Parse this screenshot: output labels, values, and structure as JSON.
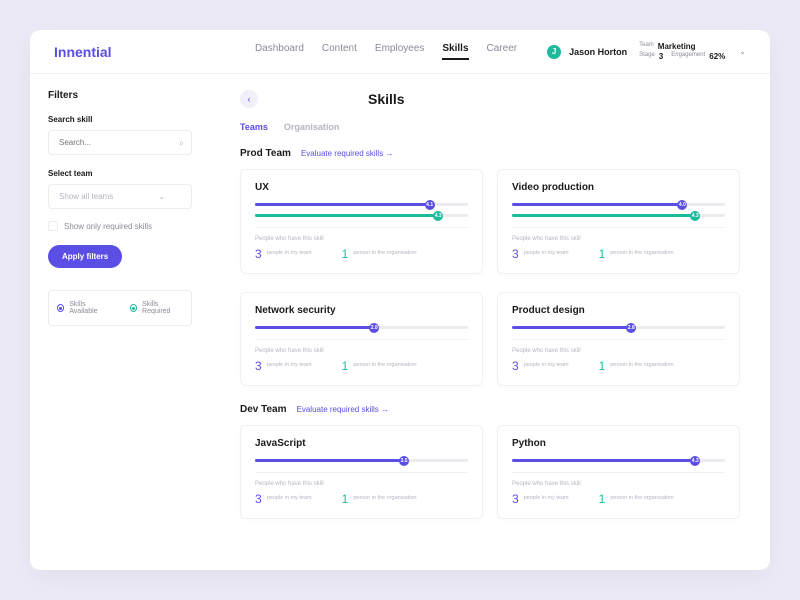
{
  "brand": "Innential",
  "nav": {
    "items": [
      "Dashboard",
      "Content",
      "Employees",
      "Skills",
      "Career"
    ],
    "activeIndex": 3
  },
  "user": {
    "initial": "J",
    "name": "Jason Horton",
    "teamLabel": "Team",
    "teamValue": "Marketing",
    "stageLabel": "Stage",
    "stageValue": "3",
    "engagementLabel": "Engagement",
    "engagementValue": "62%"
  },
  "sidebar": {
    "filtersTitle": "Filters",
    "searchLabel": "Search skill",
    "searchPlaceholder": "Search...",
    "selectTeamLabel": "Select team",
    "selectTeamValue": "Show all teams",
    "checkboxLabel": "Show only required skills",
    "applyLabel": "Apply filters",
    "legend": {
      "available": "Skills Available",
      "required": "Skills Required"
    }
  },
  "page": {
    "title": "Skills",
    "tabs": [
      "Teams",
      "Organisation"
    ],
    "activeTab": 0,
    "evaluateLabel": "Evaluate required skills →"
  },
  "teams": [
    {
      "name": "Prod Team",
      "cards": [
        {
          "title": "UX",
          "avail": 82,
          "req": 86,
          "availVal": "4.1",
          "reqVal": "4.3",
          "team": "3",
          "org": "1",
          "showReq": true
        },
        {
          "title": "Video production",
          "avail": 80,
          "req": 86,
          "availVal": "4.0",
          "reqVal": "4.3",
          "team": "3",
          "org": "1",
          "showReq": true
        },
        {
          "title": "Network security",
          "avail": 56,
          "availVal": "2.8",
          "team": "3",
          "org": "1",
          "showReq": false
        },
        {
          "title": "Product design",
          "avail": 56,
          "availVal": "2.8",
          "team": "3",
          "org": "1",
          "showReq": false
        }
      ]
    },
    {
      "name": "Dev Team",
      "cards": [
        {
          "title": "JavaScript",
          "avail": 70,
          "availVal": "3.5",
          "team": "3",
          "org": "1",
          "showReq": false
        },
        {
          "title": "Python",
          "avail": 86,
          "availVal": "4.3",
          "team": "3",
          "org": "1",
          "showReq": false
        }
      ]
    }
  ],
  "cardMeta": {
    "subLabel": "People who have this skill",
    "teamLabel": "people\nin my team",
    "orgLabel": "person\nin the organisation"
  }
}
